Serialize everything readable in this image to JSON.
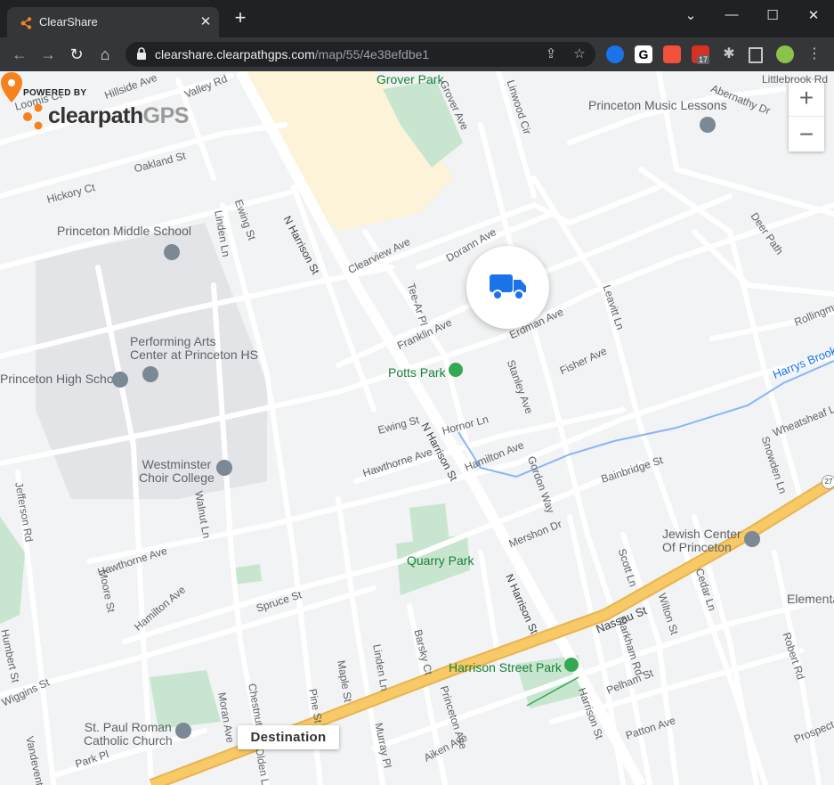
{
  "browser": {
    "tab_title": "ClearShare",
    "tab_close": "✕",
    "new_tab": "+",
    "window_controls": [
      "⌄",
      "—",
      "☐",
      "✕"
    ],
    "url_host": "clearshare.clearpathgps.com",
    "url_path": "/map/55/4e38efdbe1",
    "extension_badge": "17"
  },
  "branding": {
    "powered_by": "POWERED BY",
    "logo_part1": "clearpath",
    "logo_part2": "GPS"
  },
  "zoom": {
    "in": "+",
    "out": "−"
  },
  "marker": {
    "destination_label": "Destination"
  },
  "map_labels": {
    "streets": [
      "Valley Rd",
      "Oakland St",
      "Hickory Ct",
      "N Harrison St",
      "Ewing St",
      "Linden Ln",
      "Clearview Ave",
      "Dorann Ave",
      "Tee-Ar Pl",
      "Franklin Ave",
      "Erdman Ave",
      "Leavitt Ln",
      "Fisher Ave",
      "Stanley Ave",
      "Ewing St",
      "Hornor Ln",
      "Hawthorne Ave",
      "Hamilton Ave",
      "Gordon Way",
      "N Harrison St",
      "Bainbridge St",
      "Jefferson Rd",
      "Walnut Ln",
      "Hawthorne Ave",
      "Moore St",
      "Mershon Dr",
      "Scott Ln",
      "Cedar Ln",
      "Wilton St",
      "Nassau St",
      "Hamilton Ave",
      "Spruce St",
      "N Harrison St",
      "Markham Rd",
      "Humbert St",
      "Wiggins St",
      "Barsky Ct",
      "Linden Ln",
      "Maple St",
      "Pine St",
      "Chestnut St",
      "Moran Ave",
      "Princeton Ave",
      "Pelham St",
      "Harrison St",
      "Murray Pl",
      "Park Pl",
      "Olden Ln",
      "Aiken Ave",
      "Patton Ave",
      "Vandeventer Ave",
      "Deer Path",
      "Abernathy Dr",
      "Grover Ave",
      "Linwood Cir",
      "Snowden Ln",
      "Wheatsheaf Ln",
      "Rollingmead St",
      "Robert Rd",
      "Prospect Ave",
      "Littlebrook Rd",
      "Loomis Ct",
      "Hillside Ave",
      "Wiggins St",
      "Prospect Ave",
      "Littlebrook Rd"
    ],
    "pois": {
      "grover_park": "Grover Park",
      "music_lessons": "Princeton Music Lessons",
      "middle_school": "Princeton Middle School",
      "pac": "Performing Arts\nCenter at Princeton HS",
      "high_school": "Princeton High School",
      "potts_park": "Potts Park",
      "westminster": "Westminster\nChoir College",
      "quarry_park": "Quarry Park",
      "jewish_center": "Jewish Center\nOf Princeton",
      "harrison_park": "Harrison Street Park",
      "st_paul": "St. Paul Roman\nCatholic Church",
      "harrys_brook": "Harrys Brook",
      "elementary": "Elementa",
      "route_27": "27"
    }
  },
  "colors": {
    "map_bg": "#f1f3f4",
    "road": "#ffffff",
    "highway": "#f8c967",
    "park": "#c8e6cf",
    "campus": "#e3e4e8",
    "plaza": "#fcf3d9",
    "accent_orange": "#f5821f",
    "truck_blue": "#1a73e8"
  }
}
